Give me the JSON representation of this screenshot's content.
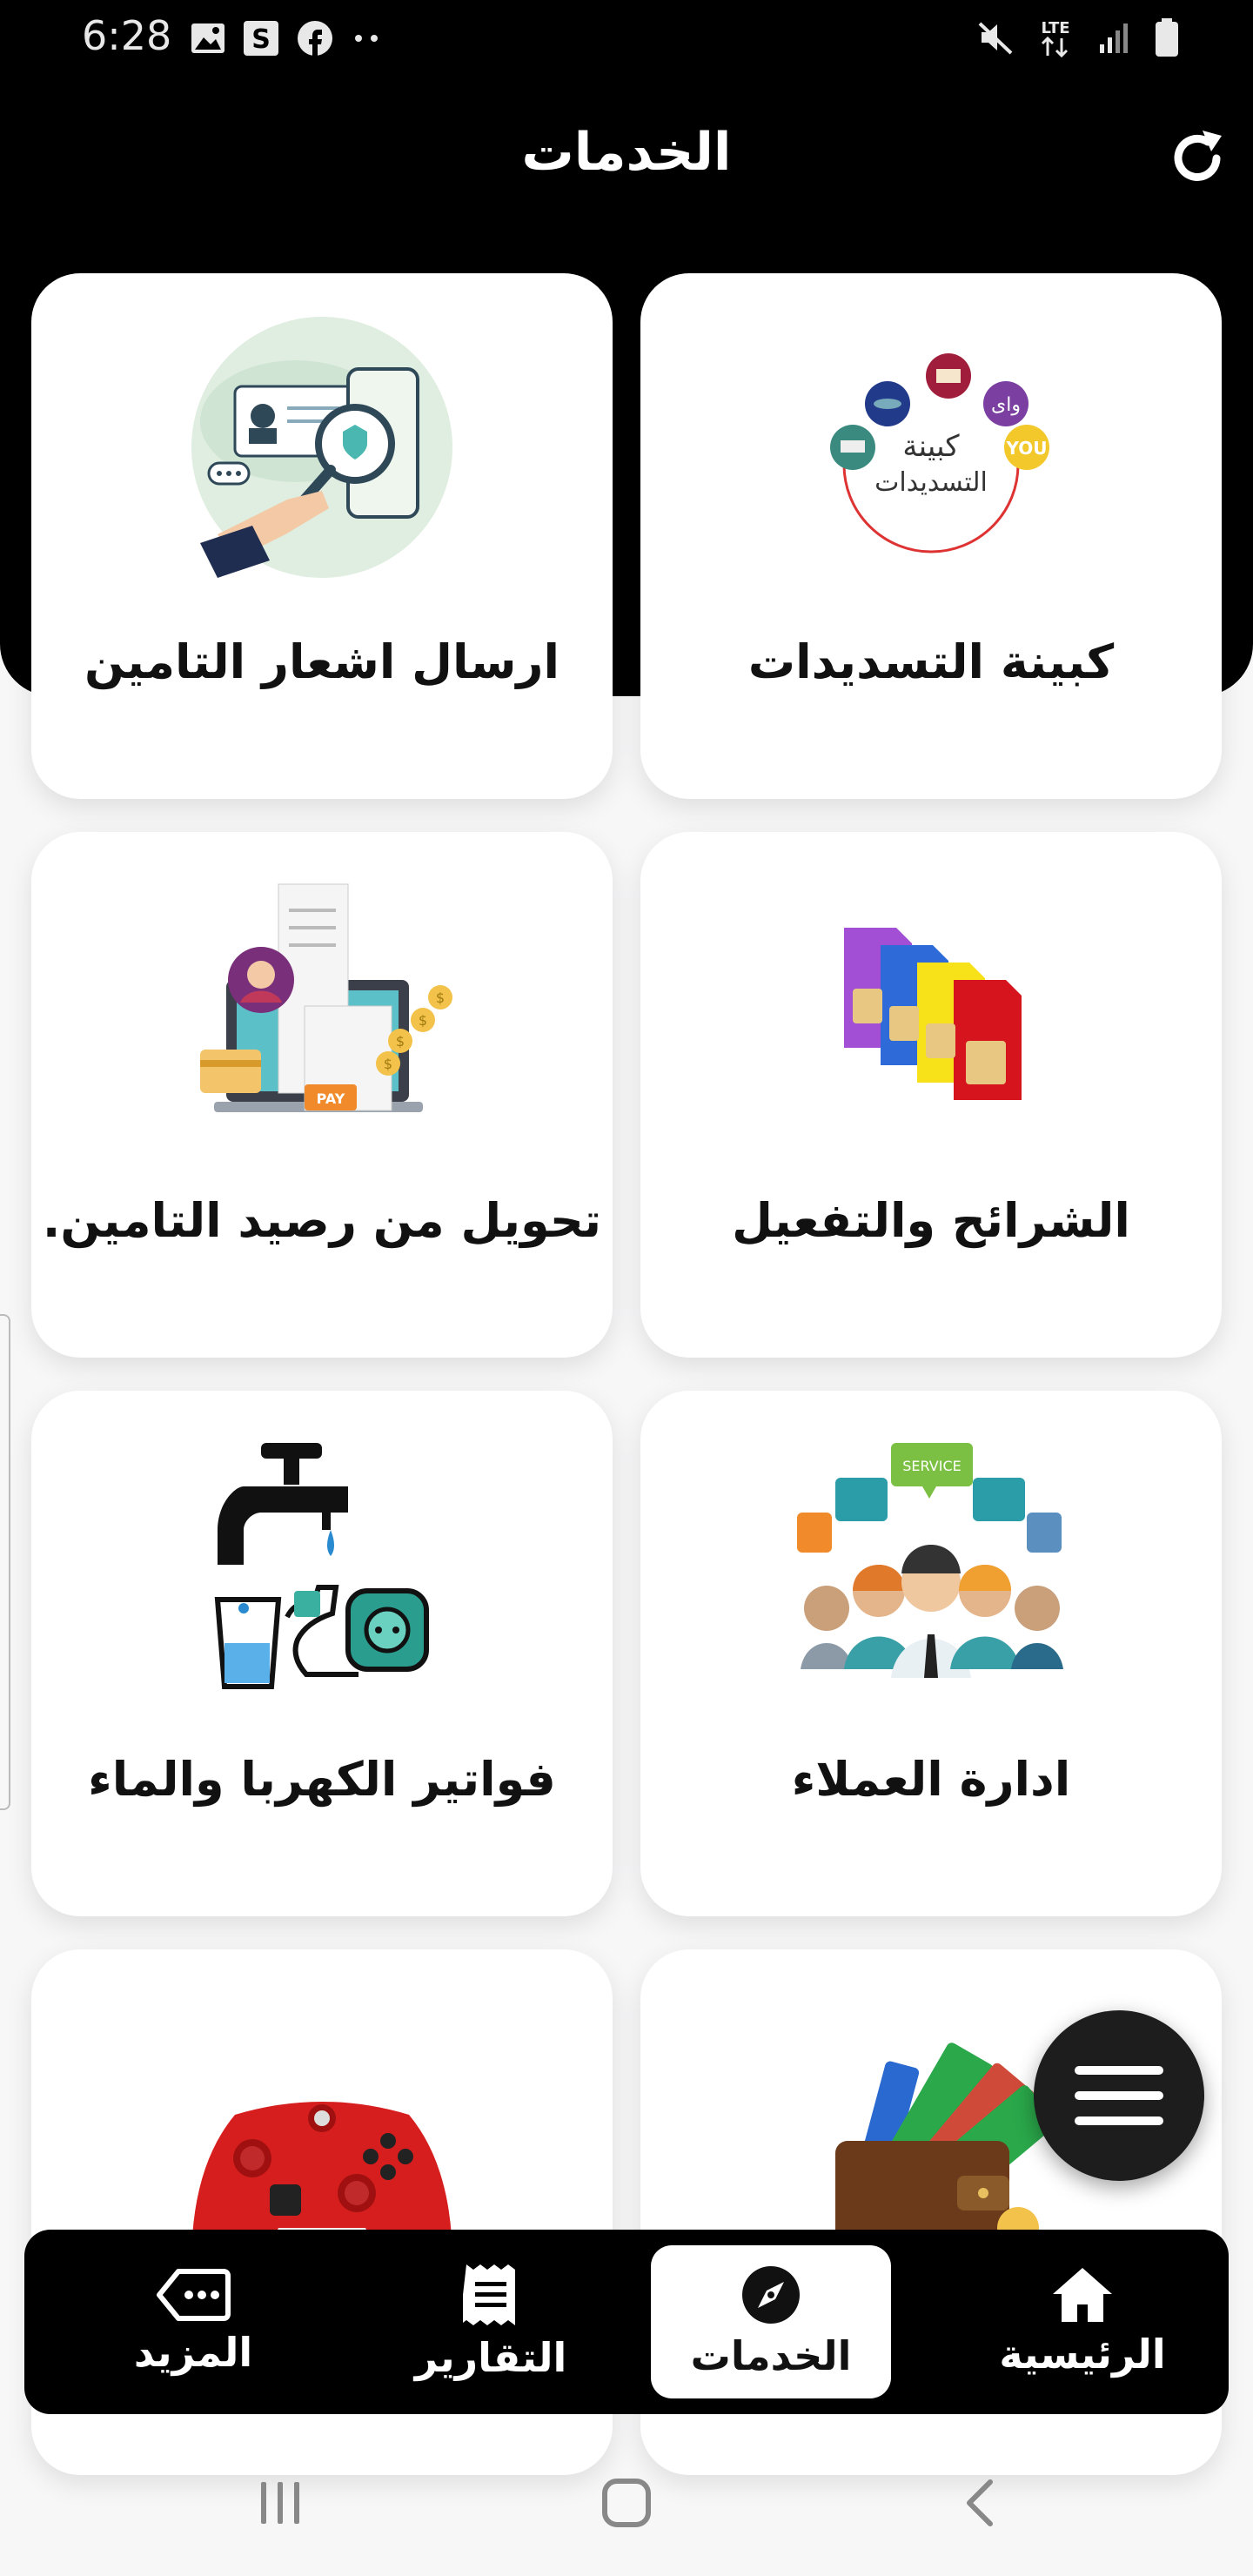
{
  "status_bar": {
    "time": "6:28",
    "left_icons": [
      "image-icon",
      "s-app-icon",
      "facebook-icon",
      "more-dots-icon"
    ],
    "right_icons": [
      "mute-icon",
      "lte-icon",
      "signal-icon",
      "battery-icon"
    ],
    "network": "LTE"
  },
  "header": {
    "title": "الخدمات",
    "refresh_icon": "refresh-icon"
  },
  "services": [
    {
      "label": "كبينة التسديدات",
      "logo_text_1": "كبينة",
      "logo_text_2": "التسديدات",
      "you_text": "YOU"
    },
    {
      "label": "ارسال اشعار التامين"
    },
    {
      "label": "الشرائح والتفعيل"
    },
    {
      "label": "تحويل من رصيد التامين.",
      "pay_text": "PAY"
    },
    {
      "label": "ادارة العملاء",
      "service_text": "SERVICE"
    },
    {
      "label": "فواتير الكهربا والماء"
    },
    {
      "label": ""
    },
    {
      "label": ""
    }
  ],
  "fab": {
    "icon": "menu-icon"
  },
  "bottom_nav": [
    {
      "label": "الرئيسية",
      "icon": "home-icon"
    },
    {
      "label": "الخدمات",
      "icon": "compass-icon"
    },
    {
      "label": "التقارير",
      "icon": "receipt-icon"
    },
    {
      "label": "المزيد",
      "icon": "more-tag-icon"
    }
  ],
  "colors": {
    "header_bg": "#000000",
    "card_bg": "#ffffff",
    "page_bg": "#f7f7f8",
    "active_nav_bg": "#ffffff"
  }
}
